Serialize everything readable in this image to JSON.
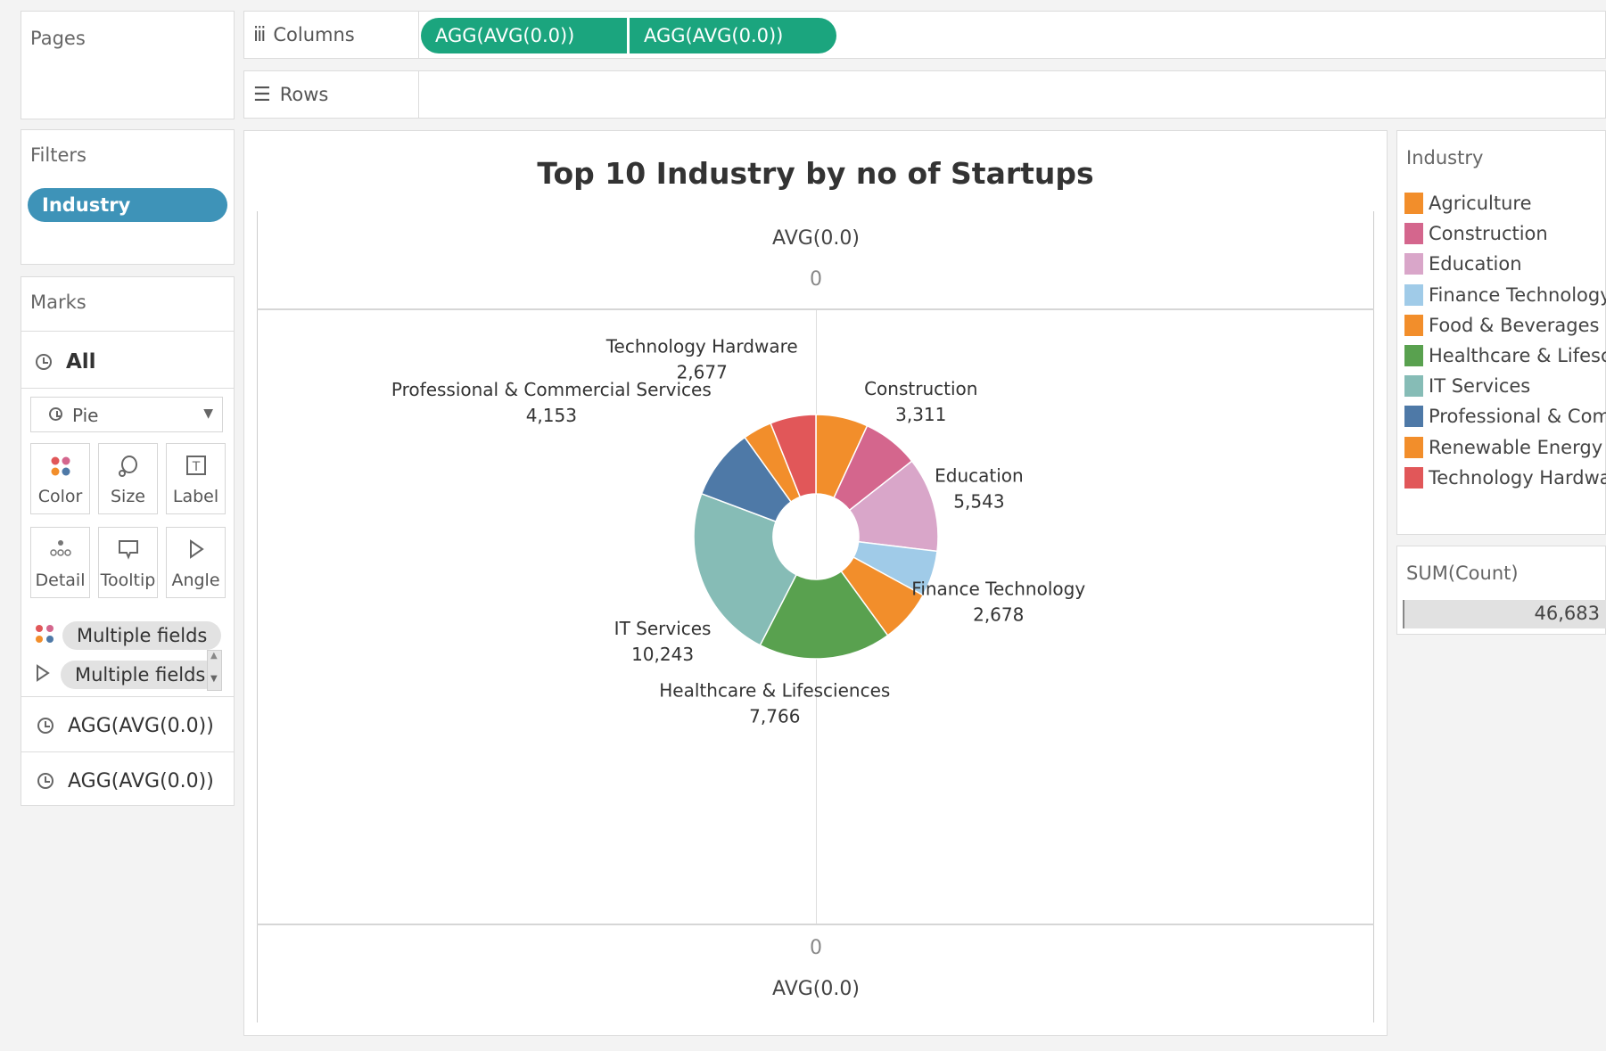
{
  "shelves": {
    "pages_label": "Pages",
    "columns_label": "Columns",
    "rows_label": "Rows",
    "columns_pills": [
      "AGG(AVG(0.0))",
      "AGG(AVG(0.0))"
    ]
  },
  "filters": {
    "title": "Filters",
    "pill": "Industry"
  },
  "marks": {
    "title": "Marks",
    "all_label": "All",
    "mark_type": "Pie",
    "buttons": {
      "color": "Color",
      "size": "Size",
      "label": "Label",
      "detail": "Detail",
      "tooltip": "Tooltip",
      "angle": "Angle"
    },
    "fields": [
      "Multiple fields",
      "Multiple fields"
    ],
    "layers": [
      "AGG(AVG(0.0))",
      "AGG(AVG(0.0))"
    ]
  },
  "axis": {
    "label": "AVG(0.0)",
    "zero": "0"
  },
  "legend": {
    "title": "Industry",
    "items": [
      {
        "label": "Agriculture",
        "color": "#f28e2b"
      },
      {
        "label": "Construction",
        "color": "#d4668d"
      },
      {
        "label": "Education",
        "color": "#d9a6c9"
      },
      {
        "label": "Finance Technology",
        "color": "#a0cbe8"
      },
      {
        "label": "Food & Beverages",
        "color": "#f28e2b"
      },
      {
        "label": "Healthcare & Lifescie..",
        "color": "#59a14f"
      },
      {
        "label": "IT Services",
        "color": "#86bcb6"
      },
      {
        "label": "Professional & Com..",
        "color": "#4e79a7"
      },
      {
        "label": "Renewable Energy",
        "color": "#f28e2b"
      },
      {
        "label": "Technology Hardware",
        "color": "#e15759"
      }
    ]
  },
  "sum": {
    "title": "SUM(Count)",
    "value": "46,683"
  },
  "chart_data": {
    "type": "pie",
    "title": "Top 10 Industry by no of Startups",
    "donut": true,
    "labels": [
      "Agriculture",
      "Construction",
      "Education",
      "Finance Technology",
      "Food & Beverages",
      "Healthcare & Lifesciences",
      "IT Services",
      "Professional & Commercial Services",
      "Renewable Energy",
      "Technology Hardware"
    ],
    "values": [
      3050,
      3311,
      5543,
      2678,
      3111,
      7766,
      10243,
      4153,
      1700,
      2677
    ],
    "colors": [
      "#f28e2b",
      "#d4668d",
      "#d9a6c9",
      "#a0cbe8",
      "#f28e2b",
      "#59a14f",
      "#86bcb6",
      "#4e79a7",
      "#f28e2b",
      "#e15759"
    ],
    "data_labels": [
      {
        "name": "Technology Hardware",
        "value": "2,677"
      },
      {
        "name": "Construction",
        "value": "3,311"
      },
      {
        "name": "Professional & Commercial Services",
        "value": "4,153"
      },
      {
        "name": "Education",
        "value": "5,543"
      },
      {
        "name": "IT Services",
        "value": "10,243"
      },
      {
        "name": "Finance Technology",
        "value": "2,678"
      },
      {
        "name": "Healthcare & Lifesciences",
        "value": "7,766"
      }
    ]
  }
}
